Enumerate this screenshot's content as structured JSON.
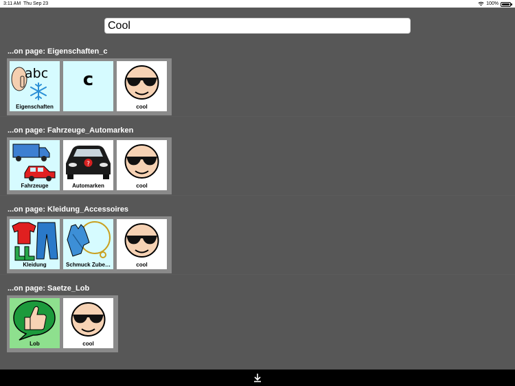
{
  "status_bar": {
    "time": "3:11 AM",
    "date": "Thu Sep 23",
    "battery": "100%"
  },
  "search": {
    "value": "Cool"
  },
  "groups": [
    {
      "label": "...on page: Eigenschaften_c",
      "tiles": [
        {
          "icon": "eigenschaften-icon",
          "caption": "Eigenschaften"
        },
        {
          "icon": "letter-c-icon",
          "letter": "c",
          "caption": ""
        },
        {
          "icon": "cool-face-icon",
          "caption": "cool"
        }
      ]
    },
    {
      "label": "...on page: Fahrzeuge_Automarken",
      "tiles": [
        {
          "icon": "vehicles-icon",
          "caption": "Fahrzeuge"
        },
        {
          "icon": "car-brands-icon",
          "caption": "Automarken"
        },
        {
          "icon": "cool-face-icon",
          "caption": "cool"
        }
      ]
    },
    {
      "label": "...on page: Kleidung_Accessoires",
      "tiles": [
        {
          "icon": "clothing-icon",
          "caption": "Kleidung"
        },
        {
          "icon": "jewelry-accessories-icon",
          "caption": "Schmuck Zube…"
        },
        {
          "icon": "cool-face-icon",
          "caption": "cool"
        }
      ]
    },
    {
      "label": "...on page: Saetze_Lob",
      "tiles": [
        {
          "icon": "thumbs-up-icon",
          "caption": "Lob"
        },
        {
          "icon": "cool-face-icon",
          "caption": "cool"
        }
      ]
    }
  ],
  "bottom_bar": {
    "icon": "download-arrow-icon"
  },
  "colors": {
    "background": "#575757",
    "tile_frame": "#8a8a8a",
    "cyan_tile": "#d6fbff",
    "green_tile": "#8ee08e"
  }
}
